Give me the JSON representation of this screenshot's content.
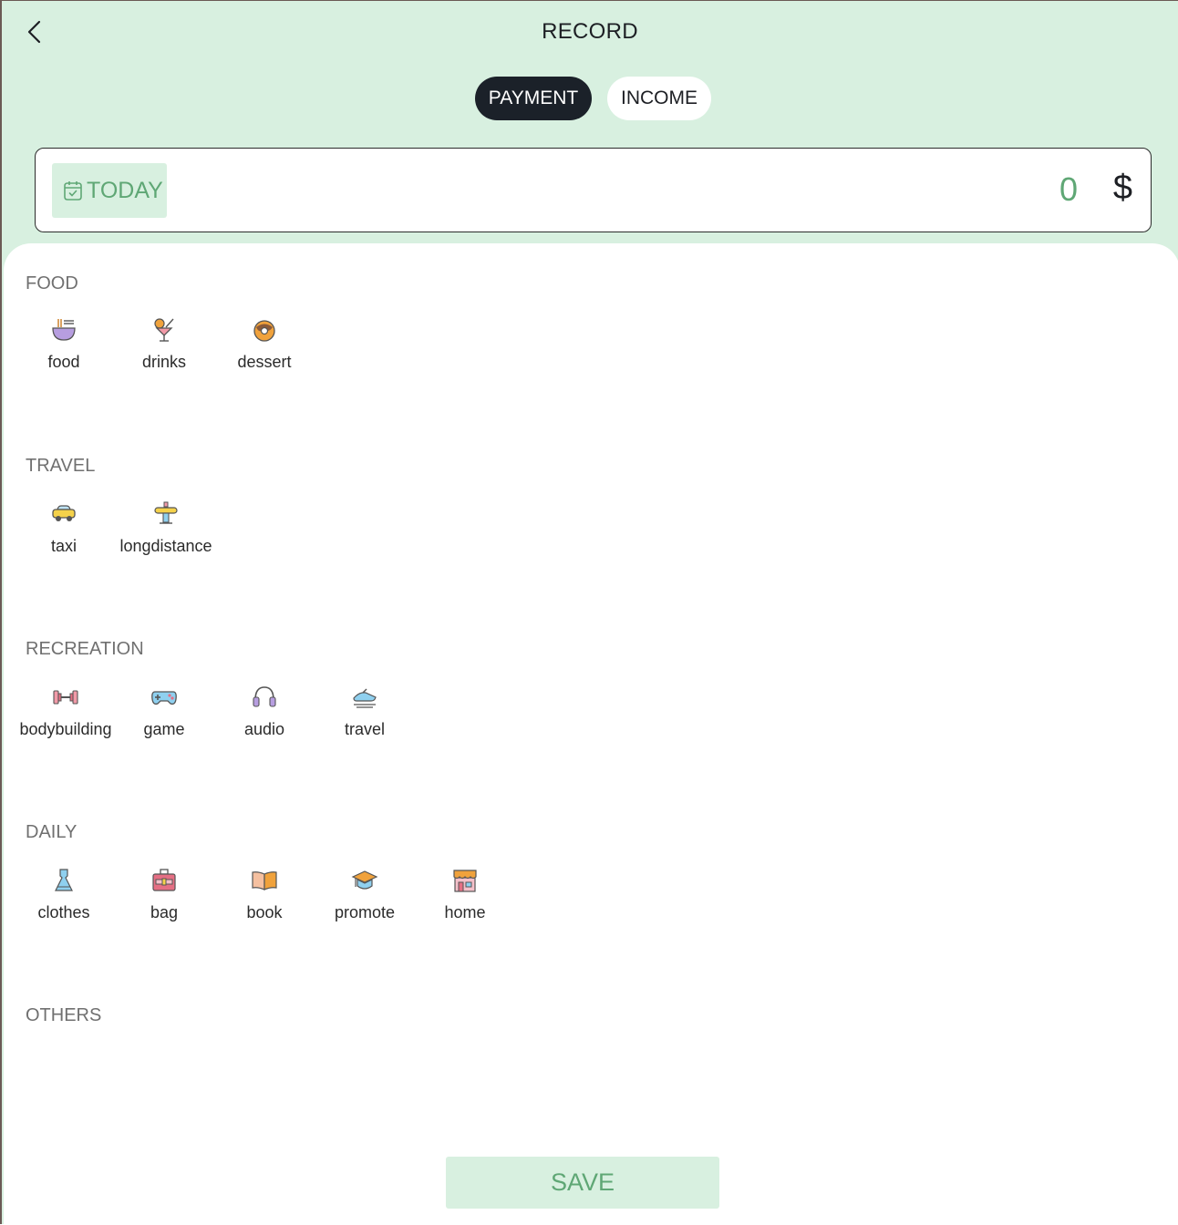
{
  "header": {
    "title": "RECORD"
  },
  "tabs": {
    "payment": "PAYMENT",
    "income": "INCOME"
  },
  "entry": {
    "date_label": "TODAY",
    "amount": "0",
    "currency": "$"
  },
  "categories": {
    "food": {
      "title": "FOOD",
      "items": [
        "food",
        "drinks",
        "dessert"
      ]
    },
    "travel": {
      "title": "TRAVEL",
      "items": [
        "taxi",
        "longdistance"
      ]
    },
    "recreation": {
      "title": "RECREATION",
      "items": [
        "bodybuilding",
        "game",
        "audio",
        "travel"
      ]
    },
    "daily": {
      "title": "DAILY",
      "items": [
        "clothes",
        "bag",
        "book",
        "promote",
        "home"
      ]
    },
    "others": {
      "title": "OTHERS",
      "items": []
    }
  },
  "actions": {
    "save": "SAVE"
  },
  "colors": {
    "header_bg": "#d8f0e0",
    "accent_green": "#5fa775",
    "tab_active": "#1b2129"
  }
}
